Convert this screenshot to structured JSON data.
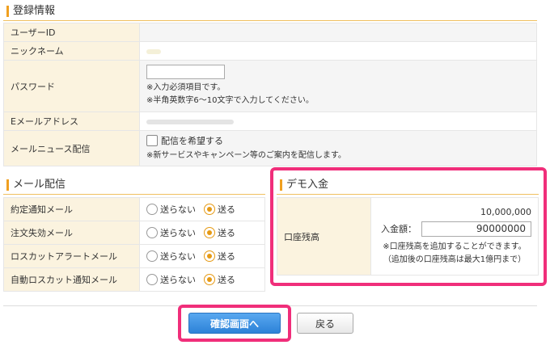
{
  "registration": {
    "heading": "登録情報",
    "user_id_label": "ユーザーID",
    "nickname_label": "ニックネーム",
    "password_label": "パスワード",
    "password_note1": "※入力必須項目です。",
    "password_note2": "※半角英数字6〜10文字で入力してください。",
    "email_label": "Eメールアドレス",
    "news_label": "メールニュース配信",
    "news_checkbox_label": "配信を希望する",
    "news_note": "※新サービスやキャンペーン等のご案内を配信します。"
  },
  "mail": {
    "heading": "メール配信",
    "option_off": "送らない",
    "option_on": "送る",
    "rows": [
      {
        "label": "約定通知メール"
      },
      {
        "label": "注文失効メール"
      },
      {
        "label": "ロスカットアラートメール"
      },
      {
        "label": "自動ロスカット通知メール"
      }
    ]
  },
  "demo": {
    "heading": "デモ入金",
    "balance_label": "口座残高",
    "current_balance": "10,000,000",
    "deposit_label": "入金額：",
    "deposit_value": "90000000",
    "note1": "※口座残高を追加することができます。",
    "note2": "（追加後の口座残高は最大1億円まで）"
  },
  "actions": {
    "confirm_label": "確認画面へ",
    "back_label": "戻る"
  },
  "colors": {
    "highlight": "#f02e7a",
    "accent": "#e69a14",
    "primary_button": "#2d82d8"
  }
}
